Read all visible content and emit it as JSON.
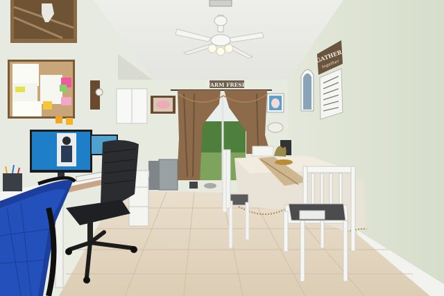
{
  "signs": {
    "farm_fresh": "FARM FRESH",
    "gather_top": "GATHER",
    "gather_bottom": "together"
  },
  "colors": {
    "wall": "#e4e8dc",
    "ceiling": "#ecedea",
    "floor_tile": "#e6d9c4",
    "curtain": "#8c6a4a",
    "table_cloth": "#e9e2d6",
    "chair_white": "#f3f3f1",
    "office_chair": "#2a2c30",
    "blue_chair": "#1c3e9c"
  },
  "icons": [
    "ceiling-fan-icon",
    "pig-icon",
    "cow-icon"
  ]
}
